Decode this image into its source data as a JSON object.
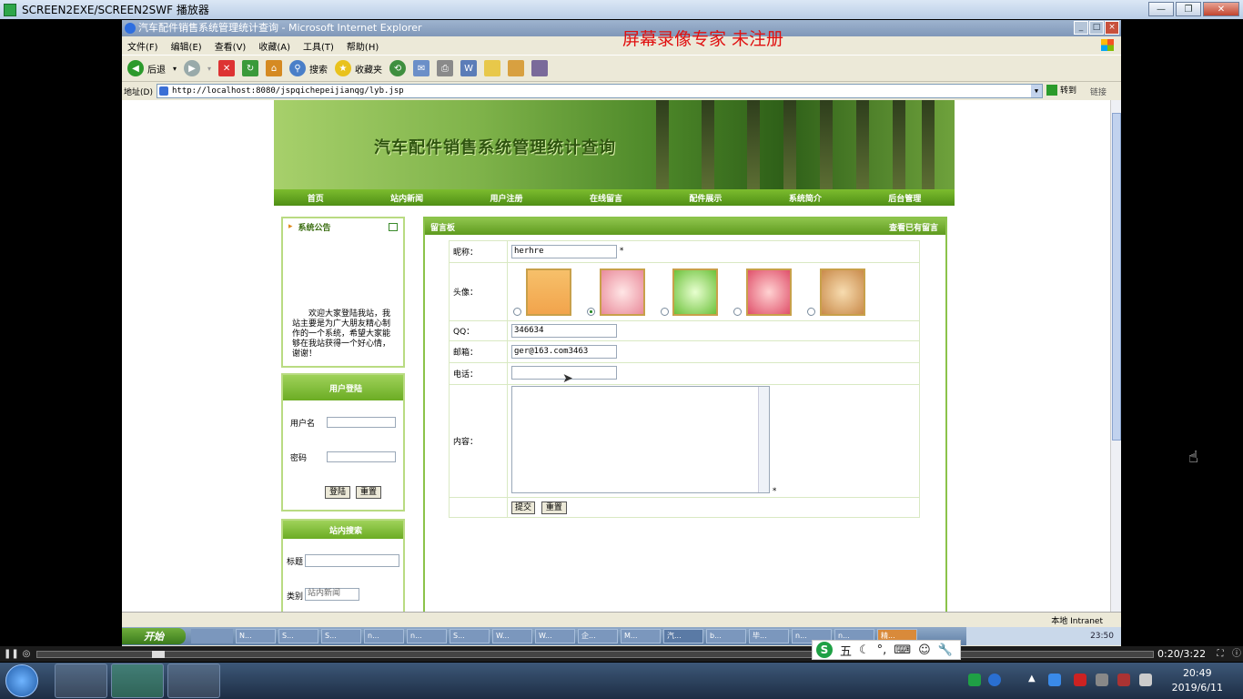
{
  "player": {
    "title": "SCREEN2EXE/SCREEN2SWF 播放器",
    "time": "0:20/3:22"
  },
  "ie": {
    "title": "汽车配件销售系统管理统计查询 - Microsoft Internet Explorer",
    "watermark": "屏幕录像专家  未注册",
    "menu": [
      "文件(F)",
      "编辑(E)",
      "查看(V)",
      "收藏(A)",
      "工具(T)",
      "帮助(H)"
    ],
    "toolbar": {
      "back": "后退",
      "search": "搜索",
      "favorites": "收藏夹"
    },
    "address_label": "地址(D)",
    "address": "http://localhost:8080/jspqichepeijianqg/lyb.jsp",
    "go": "转到",
    "links": "链接",
    "status_zone": "本地 Intranet"
  },
  "site": {
    "banner_title": "汽车配件销售系统管理统计查询",
    "nav": [
      "首页",
      "站内新闻",
      "用户注册",
      "在线留言",
      "配件展示",
      "系统简介",
      "后台管理"
    ],
    "notice": {
      "title": "系统公告",
      "text": "欢迎大家登陆我站，我站主要是为广大朋友精心制作的一个系统，希望大家能够在我站获得一个好心情，谢谢！"
    },
    "login": {
      "title": "用户登陆",
      "username_label": "用户名",
      "password_label": "密码",
      "login_btn": "登陆",
      "reset_btn": "重置"
    },
    "search": {
      "title": "站内搜索",
      "title_label": "标题",
      "category_label": "类别",
      "category_value": "站内新闻"
    },
    "board": {
      "title": "留言板",
      "view_link": "查看已有留言",
      "nickname_label": "昵称：",
      "nickname": "herhre",
      "avatar_label": "头像：",
      "avatar_selected": 2,
      "qq_label": "QQ：",
      "qq": "346634",
      "email_label": "邮箱：",
      "email": "ger@163.com3463",
      "phone_label": "电话：",
      "phone": "",
      "content_label": "内容：",
      "required_mark": "*",
      "submit": "提交",
      "reset": "重置"
    }
  },
  "taskbar": {
    "start": "开始",
    "tasks": [
      "N...",
      "S...",
      "S...",
      "n...",
      "n...",
      "S...",
      "W...",
      "W...",
      "企...",
      "M...",
      "汽...",
      "b...",
      "毕...",
      "n...",
      "n...",
      "精..."
    ],
    "rec_clock": "23:50",
    "clock_time": "20:49",
    "clock_date": "2019/6/11"
  },
  "ime": {
    "mode": "五"
  }
}
